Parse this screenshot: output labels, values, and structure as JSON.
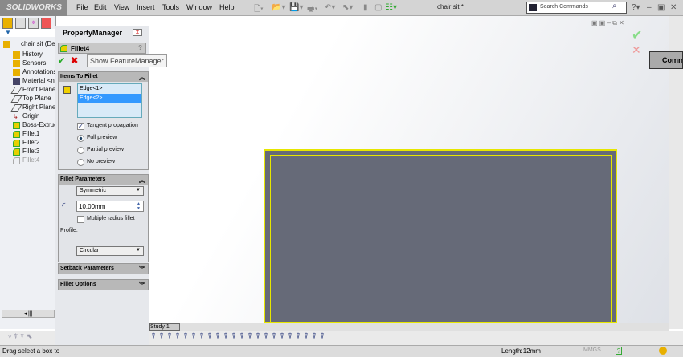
{
  "app": {
    "logo": "SOLIDWORKS",
    "doc_title": "chair sit *"
  },
  "menu": [
    "File",
    "Edit",
    "View",
    "Insert",
    "Tools",
    "Window",
    "Help"
  ],
  "search": {
    "placeholder": "Search Commands"
  },
  "tree": {
    "root": "chair sit  (De",
    "items": [
      "History",
      "Sensors",
      "Annotations",
      "Material <n",
      "Front Plane",
      "Top Plane",
      "Right Plane",
      "Origin",
      "Boss-Extrud",
      "Fillet1",
      "Fillet2",
      "Fillet3",
      "Fillet4"
    ]
  },
  "pm": {
    "title": "PropertyManager",
    "feature": "Fillet4",
    "tooltip": "Show FeatureManager",
    "items_section": {
      "title": "Items To Fillet",
      "edges": [
        "Edge<1>",
        "Edge<2>"
      ],
      "selected_edge": 1,
      "tangent_label": "Tangent propagation",
      "tangent_checked": true,
      "preview_options": [
        "Full preview",
        "Partial preview",
        "No preview"
      ],
      "preview_selected": 0
    },
    "params_section": {
      "title": "Fillet Parameters",
      "type": "Symmetric",
      "radius": "10.00mm",
      "multiple_label": "Multiple radius fillet",
      "multiple_checked": false,
      "profile_label": "Profile:",
      "profile": "Circular"
    },
    "setback_title": "Setback Parameters",
    "options_title": "Fillet Options"
  },
  "study_tab": "Study 1",
  "status": {
    "message": "Drag select a box to",
    "length": "Length:12mm",
    "units": "MMGS"
  },
  "right_tooltip": "Comm",
  "colors": {
    "part": "#666a78",
    "edge": "#e6e600",
    "selection": "#3399ff"
  }
}
